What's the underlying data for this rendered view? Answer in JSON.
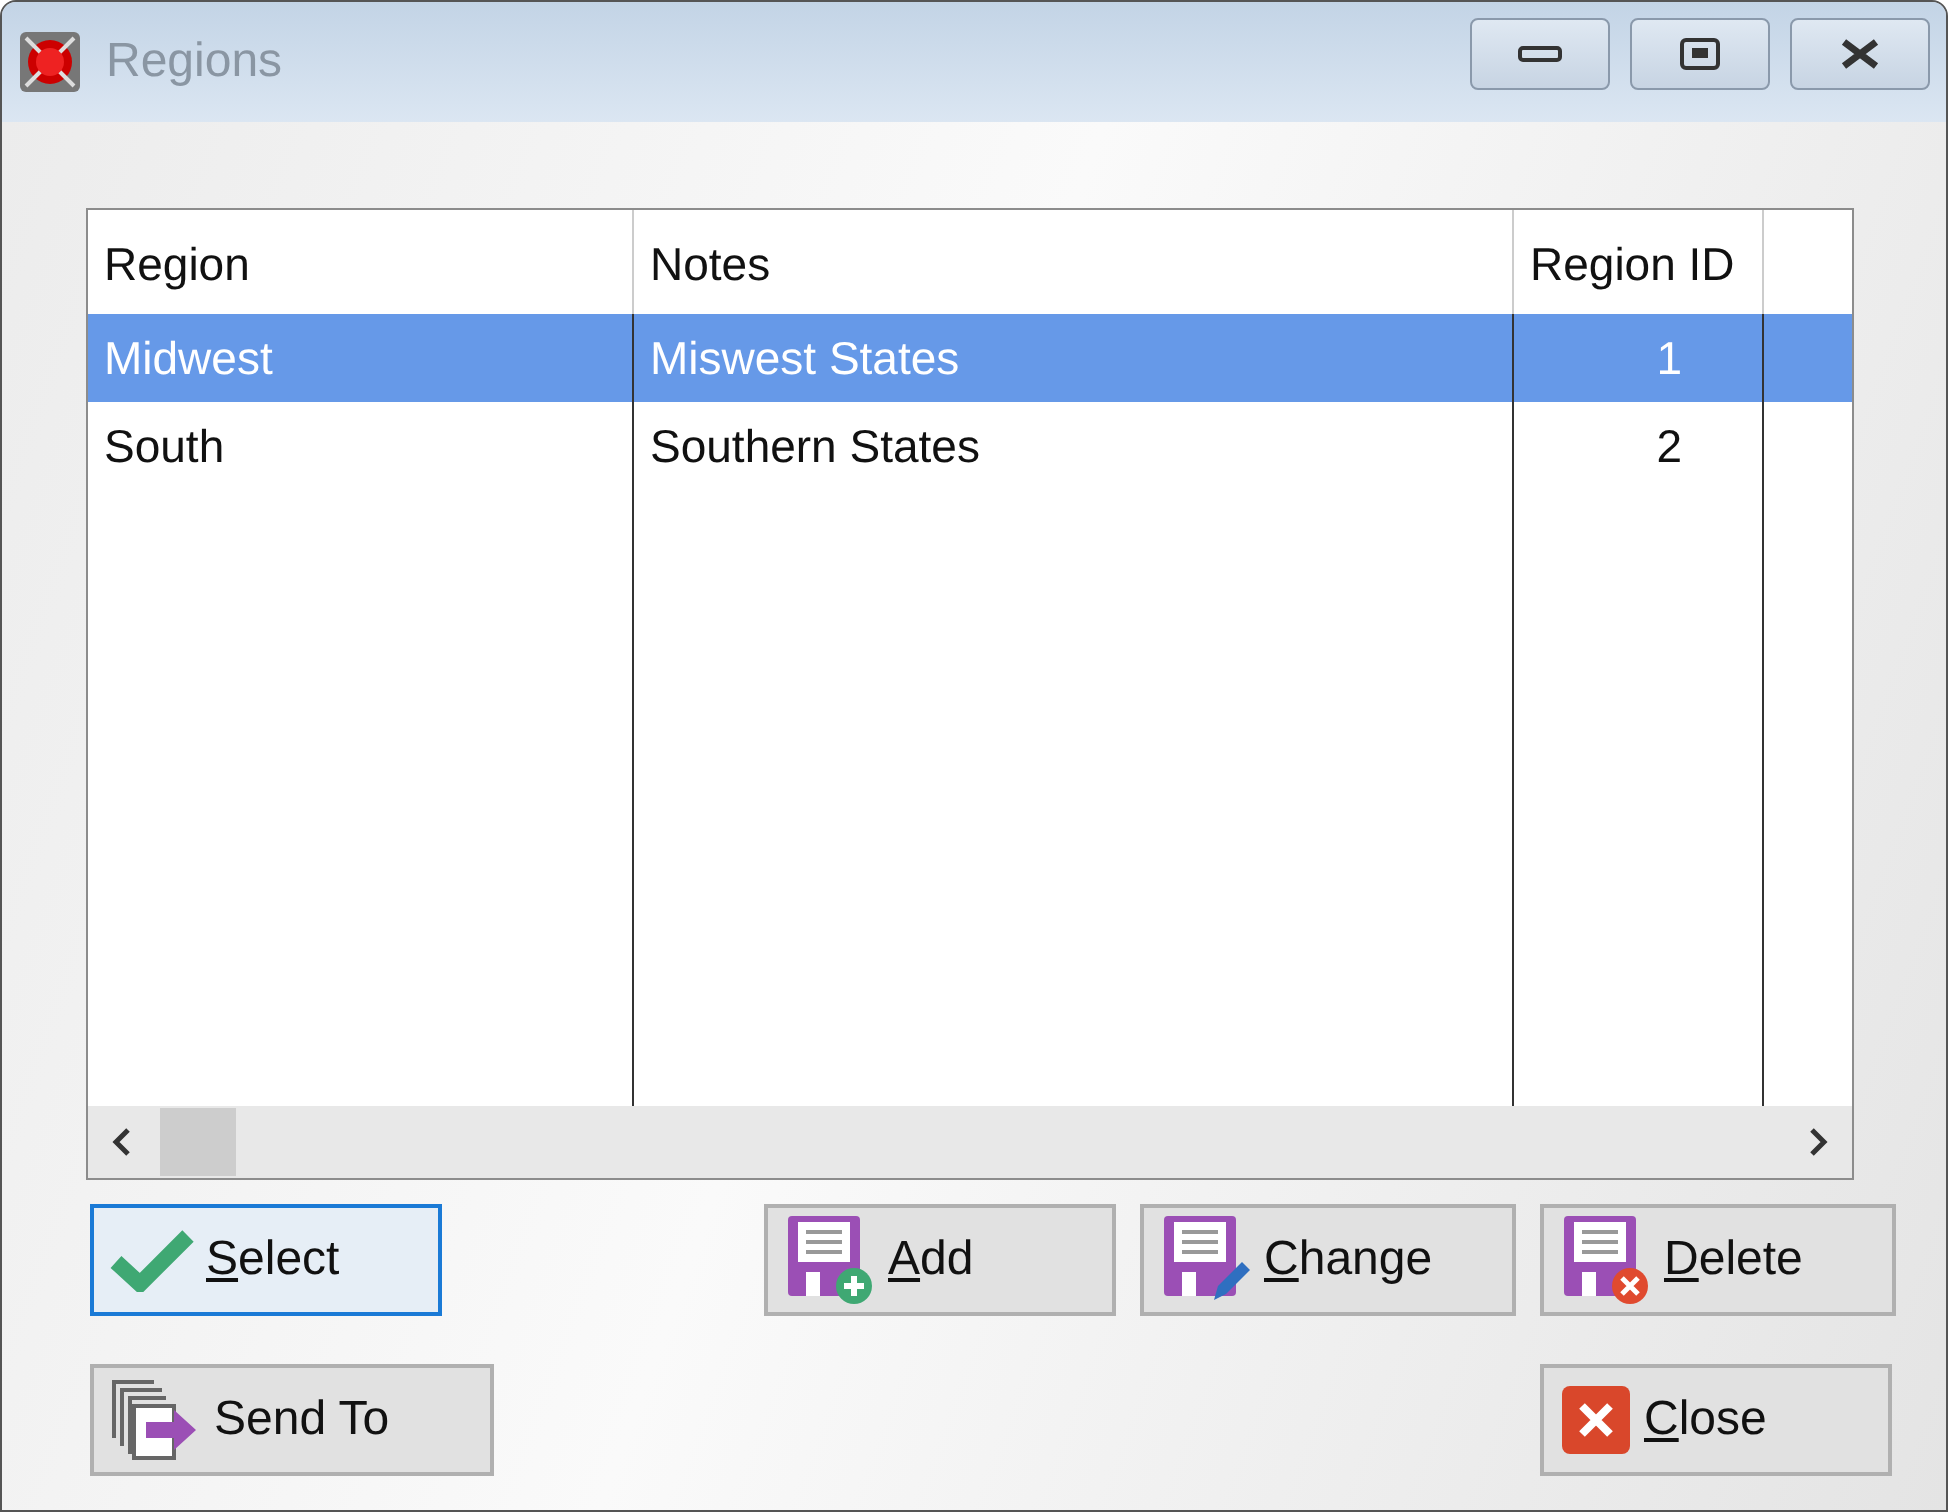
{
  "window": {
    "title": "Regions"
  },
  "table": {
    "columns": [
      "Region",
      "Notes",
      "Region ID"
    ],
    "rows": [
      {
        "cells": [
          "Midwest",
          "Miswest States",
          "1"
        ],
        "selected": true
      },
      {
        "cells": [
          "South",
          "Southern States",
          "2"
        ],
        "selected": false
      }
    ]
  },
  "buttons": [
    {
      "label": "Select",
      "kind": "check",
      "underline_first": true,
      "default": true
    },
    {
      "label": "Add",
      "kind": "save-add",
      "underline_first": true,
      "default": false
    },
    {
      "label": "Change",
      "kind": "save-edit",
      "underline_first": true,
      "default": false
    },
    {
      "label": "Delete",
      "kind": "save-delete",
      "underline_first": true,
      "default": false
    },
    {
      "label": "Send To",
      "kind": "send",
      "underline_first": false,
      "default": false
    },
    {
      "label": "Close",
      "kind": "close",
      "underline_first": true,
      "default": false
    }
  ]
}
